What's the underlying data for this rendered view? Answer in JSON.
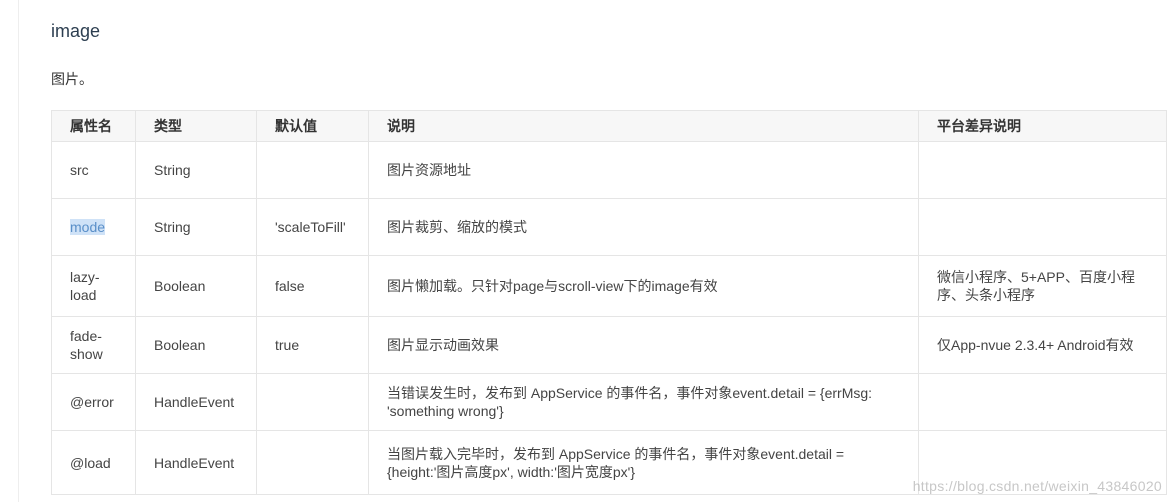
{
  "section": {
    "title": "image",
    "description": "图片。"
  },
  "table": {
    "headers": [
      "属性名",
      "类型",
      "默认值",
      "说明",
      "平台差异说明"
    ],
    "rows": [
      {
        "name": "src",
        "type": "String",
        "default": "",
        "desc": "图片资源地址",
        "platform": ""
      },
      {
        "name": "mode",
        "type": "String",
        "default": "'scaleToFill'",
        "desc": "图片裁剪、缩放的模式",
        "platform": ""
      },
      {
        "name": "lazy-load",
        "type": "Boolean",
        "default": "false",
        "desc": "图片懒加载。只针对page与scroll-view下的image有效",
        "platform": "微信小程序、5+APP、百度小程序、头条小程序"
      },
      {
        "name": "fade-show",
        "type": "Boolean",
        "default": "true",
        "desc": "图片显示动画效果",
        "platform": "仅App-nvue 2.3.4+ Android有效"
      },
      {
        "name": "@error",
        "type": "HandleEvent",
        "default": "",
        "desc": "当错误发生时，发布到 AppService 的事件名，事件对象event.detail = {errMsg: 'something wrong'}",
        "platform": ""
      },
      {
        "name": "@load",
        "type": "HandleEvent",
        "default": "",
        "desc": "当图片载入完毕时，发布到 AppService 的事件名，事件对象event.detail = {height:'图片高度px', width:'图片宽度px'}",
        "platform": ""
      }
    ]
  },
  "watermark": "https://blog.csdn.net/weixin_43846020"
}
